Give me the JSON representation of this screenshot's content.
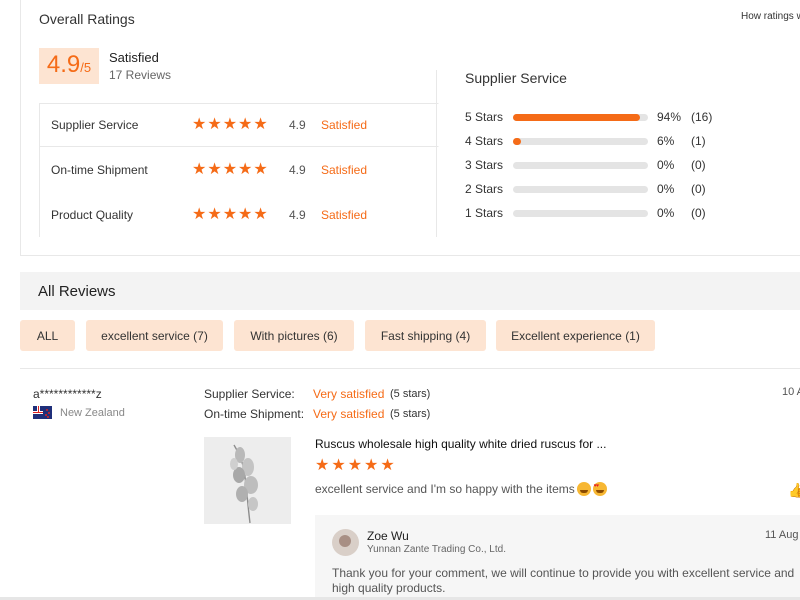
{
  "ratings": {
    "title": "Overall Ratings",
    "how_link": "How ratings w",
    "score": "4.9",
    "score_denominator": "/5",
    "summary_label": "Satisfied",
    "reviews_count": "17 Reviews",
    "metrics": [
      {
        "label": "Supplier Service",
        "rating": "4.9",
        "stars": 5,
        "status": "Satisfied",
        "selected": true
      },
      {
        "label": "On-time Shipment",
        "rating": "4.9",
        "stars": 5,
        "status": "Satisfied",
        "selected": false
      },
      {
        "label": "Product Quality",
        "rating": "4.9",
        "stars": 5,
        "status": "Satisfied",
        "selected": false
      }
    ]
  },
  "distribution": {
    "title": "Supplier Service",
    "rows": [
      {
        "label": "5 Stars",
        "percent": 94,
        "percent_label": "94%",
        "count": "(16)"
      },
      {
        "label": "4 Stars",
        "percent": 6,
        "percent_label": "6%",
        "count": "(1)"
      },
      {
        "label": "3 Stars",
        "percent": 0,
        "percent_label": "0%",
        "count": "(0)"
      },
      {
        "label": "2 Stars",
        "percent": 0,
        "percent_label": "0%",
        "count": "(0)"
      },
      {
        "label": "1 Stars",
        "percent": 0,
        "percent_label": "0%",
        "count": "(0)"
      }
    ]
  },
  "reviews_section": {
    "title": "All Reviews",
    "filters": [
      {
        "label": "ALL"
      },
      {
        "label": "excellent service (7)"
      },
      {
        "label": "With pictures (6)"
      },
      {
        "label": "Fast shipping (4)"
      },
      {
        "label": "Excellent experience (1)"
      }
    ]
  },
  "review": {
    "reviewer": "a************z",
    "country": "New Zealand",
    "date": "10 A",
    "meta": [
      {
        "label": "Supplier Service:",
        "value": "Very satisfied",
        "stars": "(5 stars)"
      },
      {
        "label": "On-time Shipment:",
        "value": "Very satisfied",
        "stars": "(5 stars)"
      }
    ],
    "product_title": "Ruscus wholesale high quality white dried ruscus for ...",
    "product_stars": 5,
    "text": "excellent service and I'm so happy with the items",
    "reply": {
      "name": "Zoe Wu",
      "company": "Yunnan Zante Trading Co., Ltd.",
      "date": "11 Aug",
      "text": "Thank you for your comment, we will continue to provide you with excellent service and high quality products."
    }
  },
  "colors": {
    "accent": "#f56b17",
    "chip_bg": "#fde4d2",
    "section_bg": "#f3f3f3"
  }
}
